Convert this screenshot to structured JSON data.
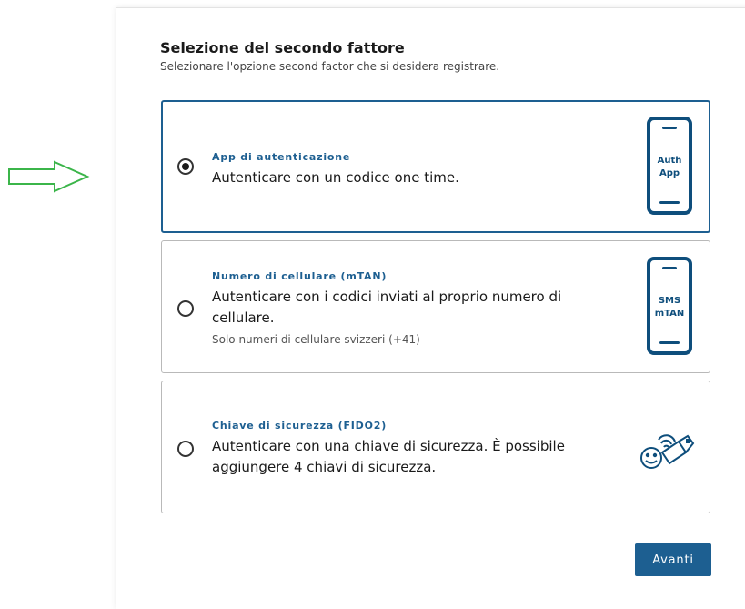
{
  "header": {
    "title": "Selezione del secondo fattore",
    "subtitle": "Selezionare l'opzione second factor che si desidera registrare."
  },
  "options": [
    {
      "label": "App di autenticazione",
      "description": "Autenticare con un codice one time.",
      "selected": true,
      "icon": "phone-icon",
      "icon_text_1": "Auth",
      "icon_text_2": "App"
    },
    {
      "label": "Numero di cellulare (mTAN)",
      "description": "Autenticare con i codici inviati al proprio numero di cellulare.",
      "note": "Solo numeri di cellulare svizzeri (+41)",
      "selected": false,
      "icon": "phone-icon",
      "icon_text_1": "SMS",
      "icon_text_2": "mTAN"
    },
    {
      "label": "Chiave di sicurezza (FIDO2)",
      "description": "Autenticare con una chiave di sicurezza. È possibile aggiungere 4 chiavi di sicurezza.",
      "selected": false,
      "icon": "security-key-icon"
    }
  ],
  "footer": {
    "next_label": "Avanti"
  },
  "colors": {
    "accent": "#1d5f91",
    "arrow": "#3bb54a"
  }
}
